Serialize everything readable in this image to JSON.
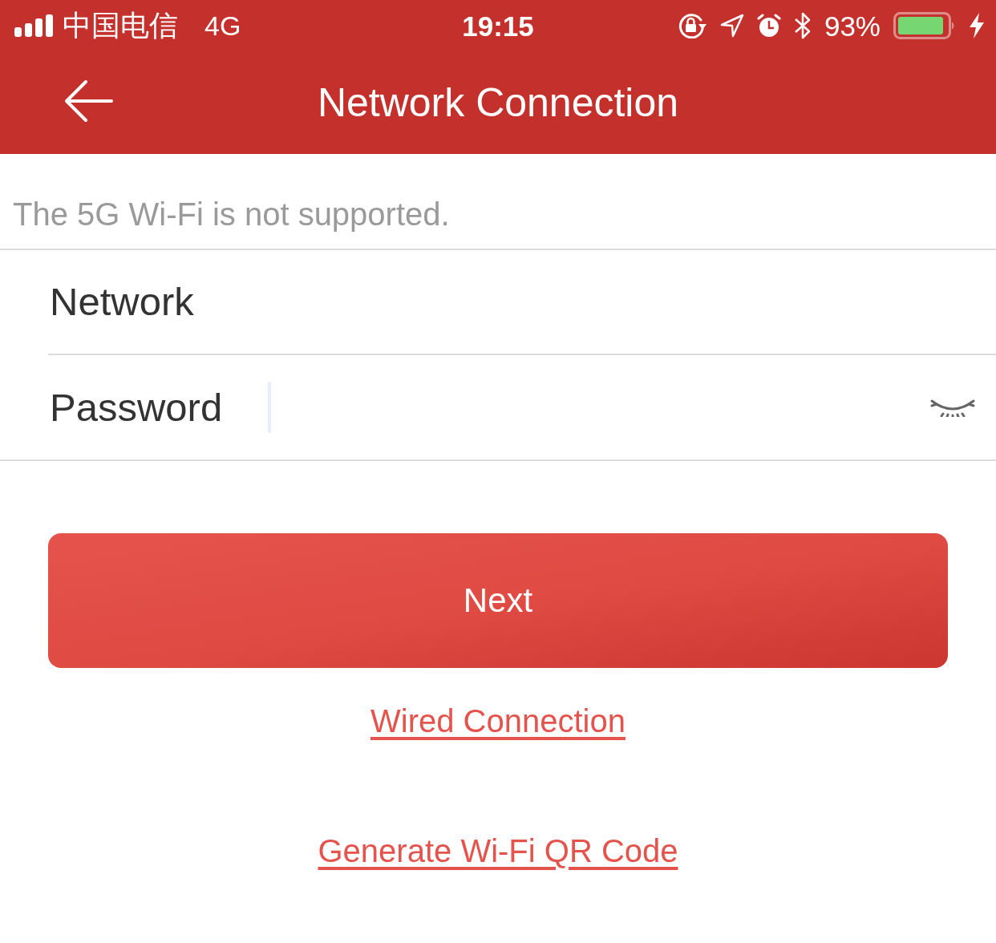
{
  "status_bar": {
    "carrier": "中国电信",
    "network": "4G",
    "time": "19:15",
    "battery": "93%"
  },
  "nav_bar": {
    "title": "Network Connection"
  },
  "notice": "The 5G Wi-Fi is not supported.",
  "form": {
    "fields": [
      {
        "kind": "text",
        "label": "Network"
      },
      {
        "kind": "password",
        "label": "Password",
        "focused": true,
        "password_visible": false
      }
    ]
  },
  "primary_button": "Next",
  "links": [
    "Wired Connection",
    "Generate Wi-Fi QR Code"
  ]
}
